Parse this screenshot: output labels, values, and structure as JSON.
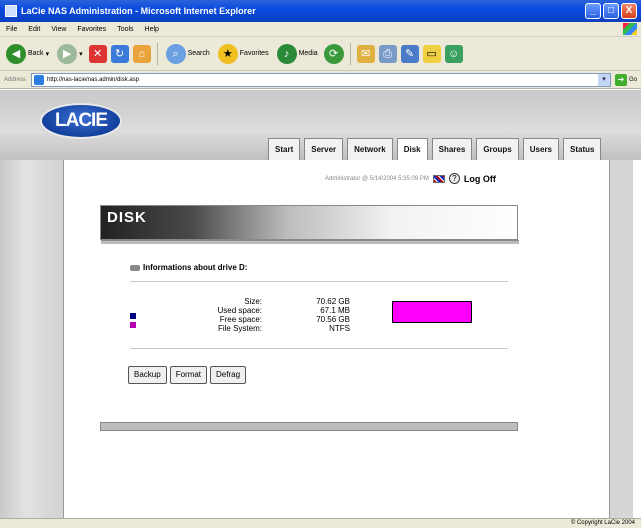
{
  "window": {
    "title": "LaCie NAS Administration - Microsoft Internet Explorer",
    "controls": [
      "_",
      "□",
      "X"
    ]
  },
  "menu": [
    "File",
    "Edit",
    "View",
    "Favorites",
    "Tools",
    "Help"
  ],
  "toolbar": {
    "back_label": "Back",
    "search_label": "Search",
    "favorites_label": "Favorites",
    "media_label": "Media"
  },
  "address": {
    "label": "Address",
    "url": "http://nas-lacie/nas.admin/disk.asp",
    "go_label": "Go"
  },
  "site": {
    "logo_text": "LACIE",
    "tabs": [
      "Start",
      "Server",
      "Network",
      "Disk",
      "Shares",
      "Groups",
      "Users",
      "Status"
    ],
    "active_tab": "Disk",
    "user_line": "Administrator @ 5/14/2004 5:35:09 PM",
    "help_label": "?",
    "logoff_label": "Log Off"
  },
  "disk": {
    "header": "DISK",
    "info_title": "Informations about drive D:",
    "rows": [
      {
        "label": "Size:",
        "value": "70.62 GB",
        "swatch": ""
      },
      {
        "label": "Used space:",
        "value": "67.1 MB",
        "swatch": "#000080"
      },
      {
        "label": "Free space:",
        "value": "70.56 GB",
        "swatch": "#b000b0"
      },
      {
        "label": "File System:",
        "value": "NTFS",
        "swatch": ""
      }
    ],
    "usage": {
      "used_fraction": 0.001,
      "used_color": "#000080",
      "free_color": "#ff00ff"
    },
    "buttons": [
      "Backup",
      "Format",
      "Defrag"
    ]
  },
  "status": {
    "copyright": "© Copyright LaCie 2004"
  }
}
